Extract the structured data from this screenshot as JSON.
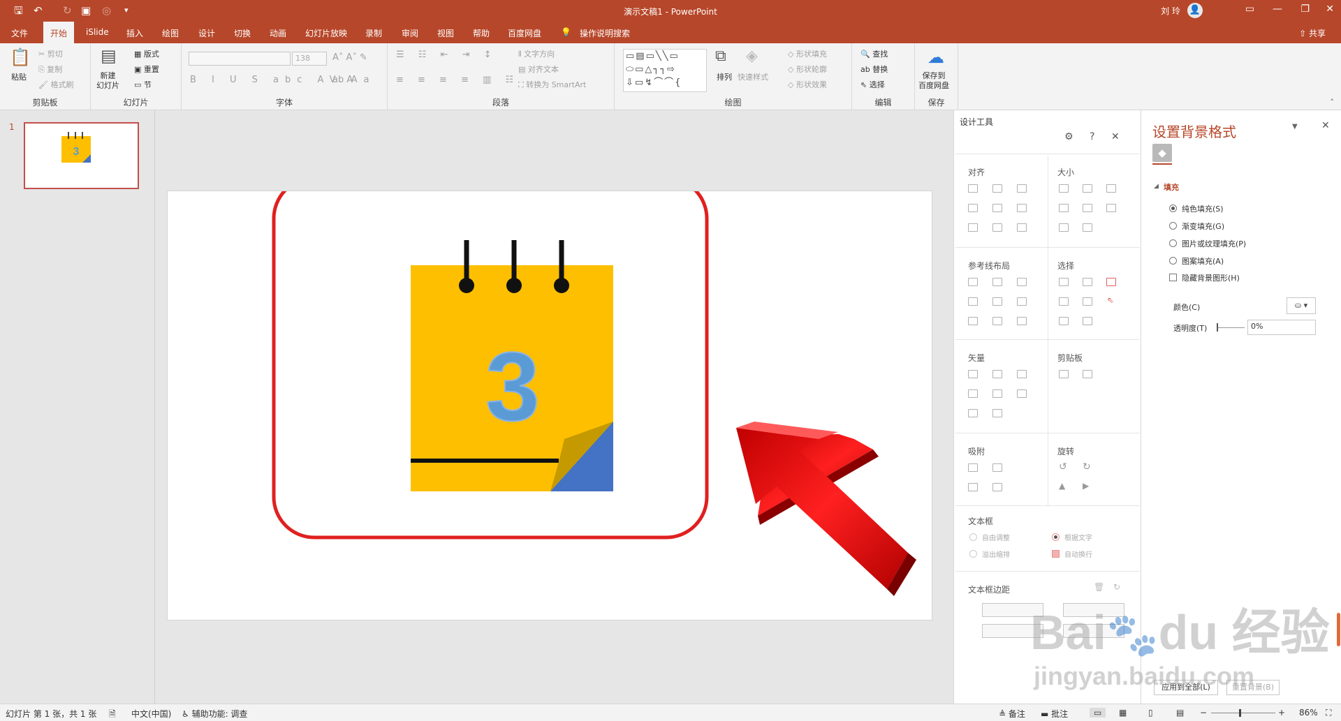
{
  "app": {
    "window_title": "演示文稿1 - PowerPoint",
    "user_name": "刘 玲",
    "share_label": "共享"
  },
  "tabs": [
    "文件",
    "开始",
    "iSlide",
    "插入",
    "绘图",
    "设计",
    "切换",
    "动画",
    "幻灯片放映",
    "录制",
    "审阅",
    "视图",
    "帮助",
    "百度网盘"
  ],
  "active_tab": "开始",
  "tell_me": "操作说明搜索",
  "ribbon": {
    "clipboard": {
      "label": "剪贴板",
      "paste": "粘贴",
      "cut": "剪切",
      "copy": "复制",
      "format_painter": "格式刷"
    },
    "slides": {
      "label": "幻灯片",
      "new_slide": "新建\n幻灯片",
      "layout": "版式",
      "reset": "重置",
      "section": "节"
    },
    "font": {
      "label": "字体",
      "size": "138"
    },
    "paragraph": {
      "label": "段落",
      "text_direction": "文字方向",
      "align_text": "对齐文本",
      "smartart": "转换为 SmartArt"
    },
    "drawing": {
      "label": "绘图",
      "arrange": "排列",
      "quick_styles": "快速样式",
      "shape_fill": "形状填充",
      "shape_outline": "形状轮廓",
      "shape_effects": "形状效果"
    },
    "editing": {
      "label": "编辑",
      "find": "查找",
      "replace": "替换",
      "select": "选择"
    },
    "save": {
      "label": "保存",
      "save_to_baidu": "保存到\n百度网盘"
    }
  },
  "slide_panel": {
    "number": "1"
  },
  "slide": {
    "calendar_number": "3"
  },
  "design_tools": {
    "title": "设计工具",
    "sections": [
      "对齐",
      "大小",
      "参考线布局",
      "选择",
      "矢量",
      "剪贴板",
      "吸附",
      "旋转",
      "文本框",
      "文本框边距"
    ],
    "textbox_options": [
      "自由调整",
      "溢出缩排",
      "根据文字",
      "自动换行"
    ]
  },
  "format_pane": {
    "title": "设置背景格式",
    "section": "填充",
    "options": [
      "纯色填充(S)",
      "渐变填充(G)",
      "图片或纹理填充(P)",
      "图案填充(A)"
    ],
    "selected_option": "纯色填充(S)",
    "checkbox": "隐藏背景图形(H)",
    "color_label": "颜色(C)",
    "transparency_label": "透明度(T)",
    "transparency_value": "0%",
    "apply_all": "应用到全部(L)",
    "reset": "重置背景(B)"
  },
  "status": {
    "slide_info": "幻灯片 第 1 张，共 1 张",
    "language": "中文(中国)",
    "accessibility": "辅助功能: 调查",
    "notes": "备注",
    "comments": "批注",
    "zoom": "86%"
  },
  "watermark": {
    "brand": "Bai",
    "brand2": "du",
    "cn": "经验",
    "url": "jingyan.baidu.com"
  },
  "colors": {
    "accent": "#b7472a",
    "calendar_yellow": "#fdbf00",
    "number_blue": "#5b9bd5",
    "fold_blue": "#4472c4",
    "frame_red": "#e02020",
    "arrow_red": "#ee1111"
  }
}
